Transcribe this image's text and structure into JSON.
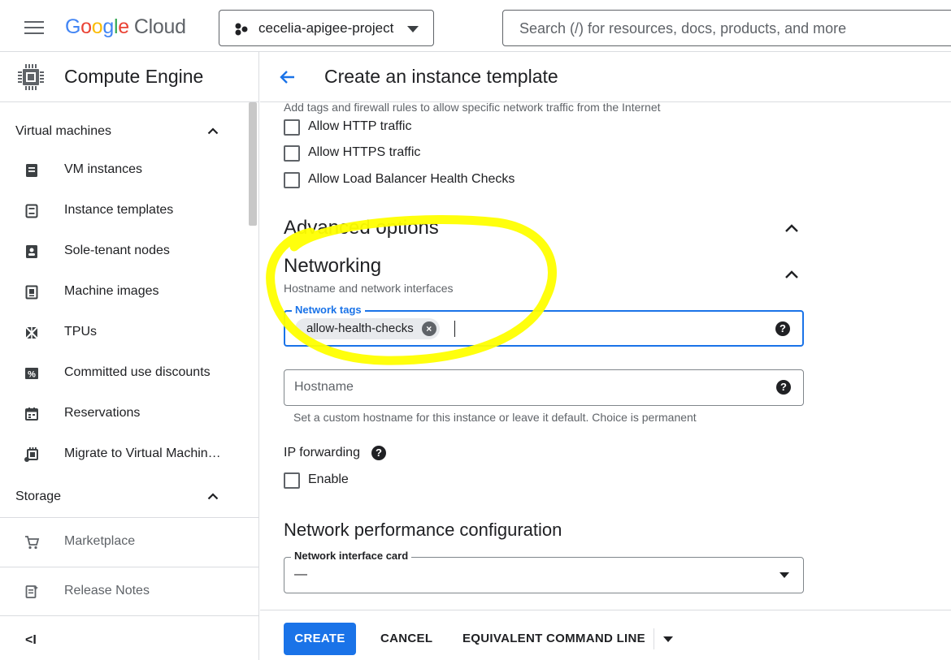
{
  "topbar": {
    "logo_letters": [
      "G",
      "o",
      "o",
      "g",
      "l",
      "e"
    ],
    "logo_cloud": "Cloud",
    "project_name": "cecelia-apigee-project",
    "search_placeholder": "Search (/) for resources, docs, products, and more"
  },
  "sidebar": {
    "title": "Compute Engine",
    "sections": [
      {
        "label": "Virtual machines",
        "items": [
          {
            "label": "VM instances",
            "icon": "vm-instances-icon"
          },
          {
            "label": "Instance templates",
            "icon": "instance-templates-icon"
          },
          {
            "label": "Sole-tenant nodes",
            "icon": "sole-tenant-nodes-icon"
          },
          {
            "label": "Machine images",
            "icon": "machine-images-icon"
          },
          {
            "label": "TPUs",
            "icon": "tpu-icon"
          },
          {
            "label": "Committed use discounts",
            "icon": "percent-icon"
          },
          {
            "label": "Reservations",
            "icon": "calendar-icon"
          },
          {
            "label": "Migrate to Virtual Machin…",
            "icon": "migrate-icon"
          }
        ]
      },
      {
        "label": "Storage",
        "items": []
      }
    ],
    "footer_items": [
      {
        "label": "Marketplace",
        "icon": "cart-icon"
      },
      {
        "label": "Release Notes",
        "icon": "release-notes-icon"
      }
    ],
    "collapse_glyph": "<I"
  },
  "main": {
    "title": "Create an instance template",
    "firewall_hint": "Add tags and firewall rules to allow specific network traffic from the Internet",
    "firewall_checkboxes": [
      {
        "label": "Allow HTTP traffic",
        "checked": false
      },
      {
        "label": "Allow HTTPS traffic",
        "checked": false
      },
      {
        "label": "Allow Load Balancer Health Checks",
        "checked": false
      }
    ],
    "advanced_heading": "Advanced options",
    "networking_heading": "Networking",
    "networking_sub": "Hostname and network interfaces",
    "network_tags": {
      "label": "Network tags",
      "chips": [
        "allow-health-checks"
      ],
      "help": "?"
    },
    "hostname": {
      "placeholder": "Hostname",
      "hint": "Set a custom hostname for this instance or leave it default. Choice is permanent",
      "help": "?"
    },
    "ip_forwarding": {
      "label": "IP forwarding",
      "help": "?",
      "checkbox_label": "Enable",
      "checked": false
    },
    "perf_heading": "Network performance configuration",
    "nic": {
      "label": "Network interface card",
      "value": "—"
    }
  },
  "actions": {
    "create": "CREATE",
    "cancel": "CANCEL",
    "command_line": "EQUIVALENT COMMAND LINE"
  },
  "colors": {
    "accent": "#1a73e8",
    "highlight": "#ffff00"
  }
}
